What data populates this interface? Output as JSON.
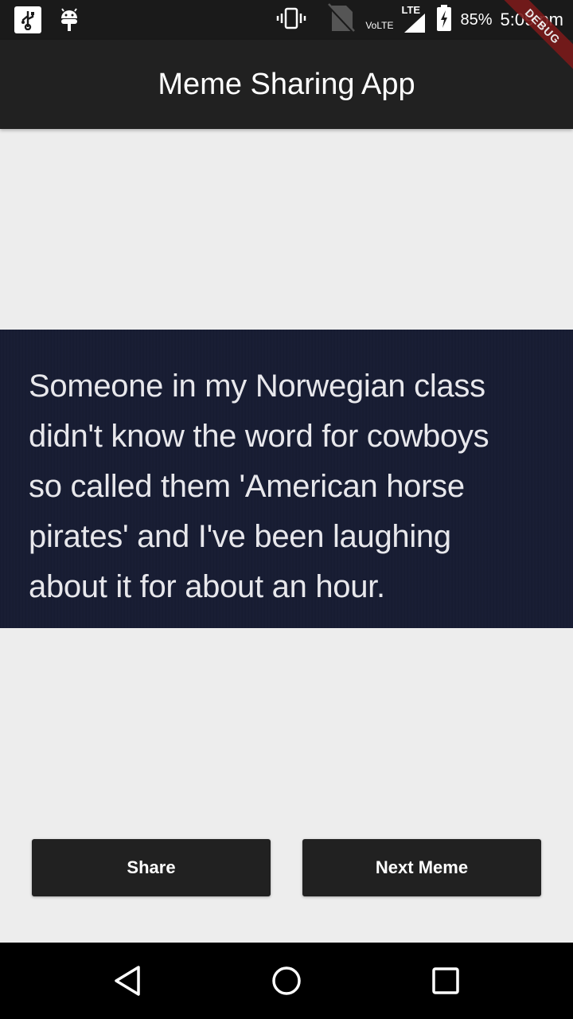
{
  "status_bar": {
    "battery": "85%",
    "time": "5:09 pm",
    "network": "LTE",
    "volte": "VoLTE",
    "icons": [
      "usb-icon",
      "android-debug-icon",
      "vibrate-icon",
      "no-sim-icon",
      "signal-icon",
      "battery-charging-icon"
    ]
  },
  "debug_banner": "DEBUG",
  "app_bar": {
    "title": "Meme Sharing App"
  },
  "meme": {
    "lines": [
      "Someone in my Norwegian class",
      "didn't know the word for cowboys",
      "so called them 'American horse",
      "pirates' and I've been laughing",
      "about it for about an hour."
    ]
  },
  "buttons": {
    "share_label": "Share",
    "next_label": "Next Meme"
  },
  "nav_bar": {
    "icons": [
      "back-icon",
      "home-icon",
      "recents-icon"
    ]
  },
  "colors": {
    "app_bar": "#212121",
    "background": "#ededed",
    "meme_background": "#181d33",
    "button": "#212121"
  }
}
